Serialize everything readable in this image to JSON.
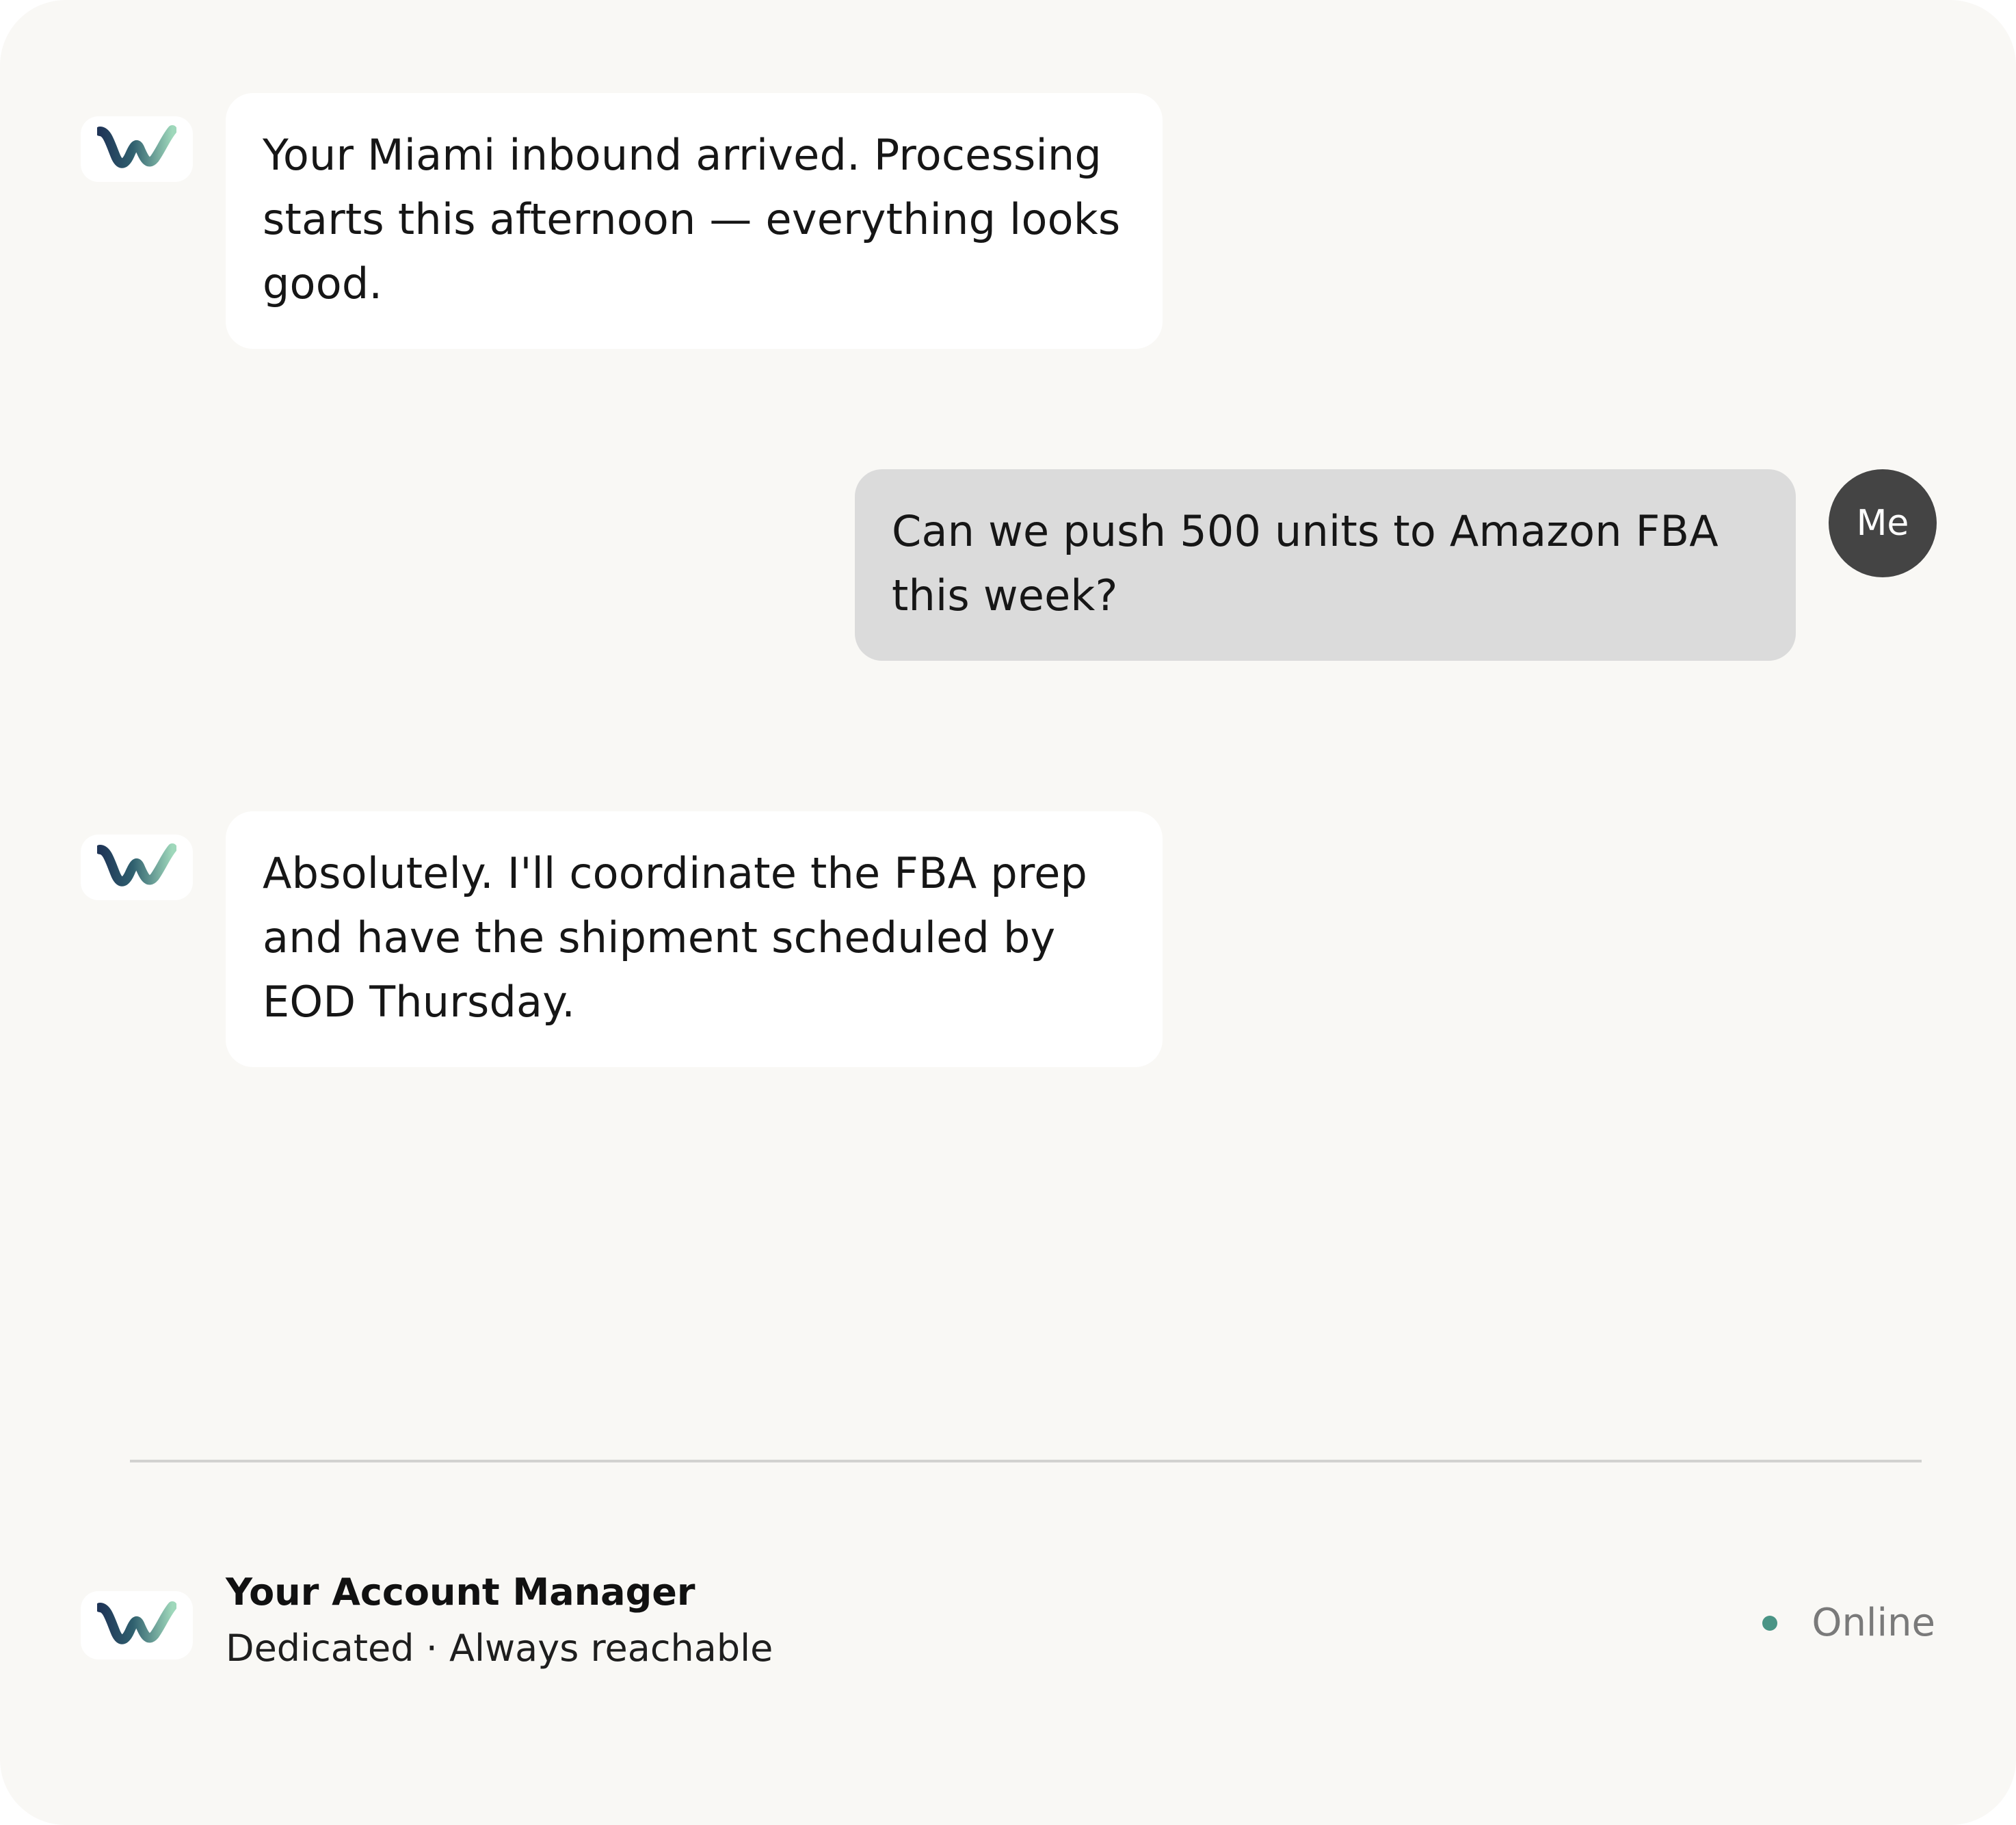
{
  "messages": [
    {
      "sender": "agent",
      "avatar_icon": "brand-logo-icon",
      "text": "Your Miami inbound arrived. Processing starts this afternoon — everything looks good."
    },
    {
      "sender": "user",
      "avatar_label": "Me",
      "text": "Can we push 500 units to Amazon FBA this week?"
    },
    {
      "sender": "agent",
      "avatar_icon": "brand-logo-icon",
      "text": "Absolutely. I'll coordinate the FBA prep and have the shipment scheduled by EOD Thursday."
    }
  ],
  "footer": {
    "title": "Your Account Manager",
    "subtitle": "Dedicated · Always reachable",
    "status": "Online"
  },
  "colors": {
    "background": "#f9f8f5",
    "agent_bubble": "#ffffff",
    "user_bubble": "#dbdbdb",
    "user_avatar": "#444444",
    "status_dot": "#4a9485",
    "logo_dark": "#1f3557",
    "logo_light": "#8fd0b0"
  }
}
